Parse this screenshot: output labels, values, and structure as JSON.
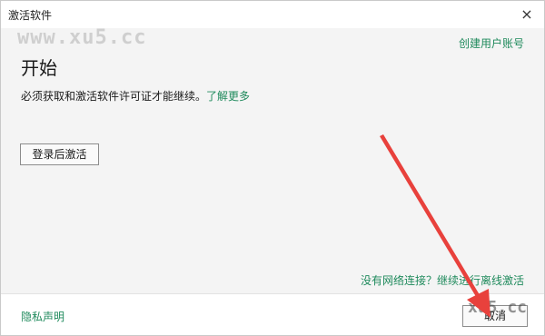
{
  "window": {
    "title": "激活软件",
    "close_icon": "×"
  },
  "watermarks": {
    "top": "www.xu5.cc",
    "bottom": "xu5.cc"
  },
  "header": {
    "create_account_link": "创建用户账号"
  },
  "main": {
    "heading": "开始",
    "description": "必须获取和激活软件许可证才能继续。",
    "learn_more_link": "了解更多",
    "login_button": "登录后激活",
    "offline_link": "没有网络连接？继续进行离线激活"
  },
  "footer": {
    "privacy_link": "隐私声明",
    "cancel_button": "取消"
  },
  "colors": {
    "accent": "#1f8a5c",
    "annotation_arrow": "#e8413c"
  }
}
